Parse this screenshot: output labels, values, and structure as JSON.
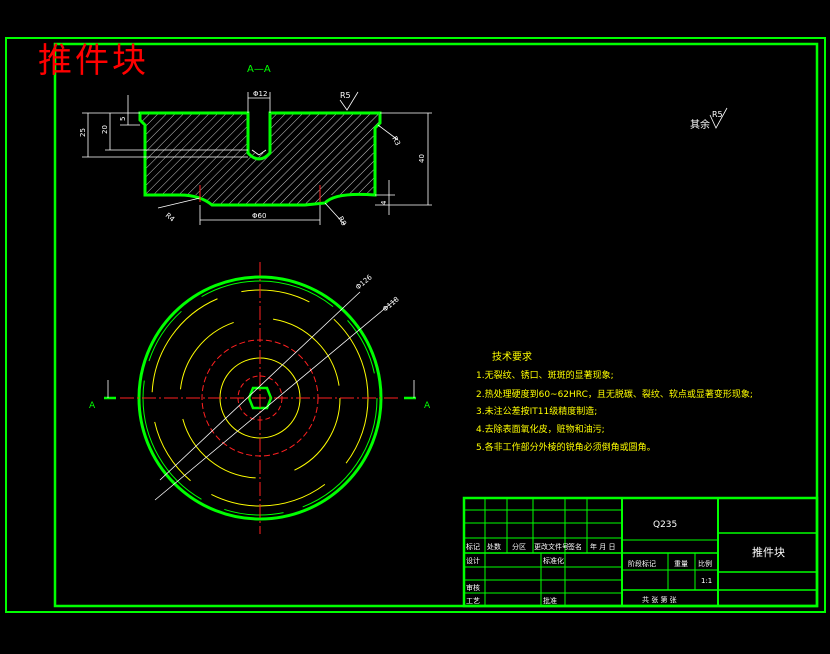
{
  "drawing": {
    "title": "推件块",
    "section_label": "A—A",
    "section_mark_left": "A",
    "section_mark_right": "A",
    "surface_finish_main": "R5",
    "surface_finish_rest_label": "其余",
    "surface_finish_rest": "R5"
  },
  "dimensions": {
    "top_hole": "Φ12",
    "height_25": "25",
    "height_20": "20",
    "depth_5": "5",
    "total_40": "40",
    "step_4": "4",
    "radius_r3": "R3",
    "radius_r4": "R4",
    "radius_r8": "R8",
    "bottom_dia": "Φ60",
    "dia_126": "Φ126",
    "dia_118": "Φ118"
  },
  "tech_requirements": {
    "heading": "技术要求",
    "items": [
      "1.无裂纹、锈口、斑斑的显著现象;",
      "2.热处理硬度到60~62HRC，且无脱碳、裂纹、软点或显著变形现象;",
      "3.未注公差按IT11级精度制造;",
      "4.去除表面氧化皮，赃物和油污;",
      "5.各非工作部分外棱的锐角必须倒角或圆角。"
    ]
  },
  "title_block": {
    "material": "Q235",
    "part_name": "推件块",
    "header_row": [
      "标记",
      "处数",
      "分区",
      "更改文件号",
      "签名",
      "年 月 日"
    ],
    "design_label": "设计",
    "standardize_label": "标准化",
    "review_label": "审核",
    "process_label": "工艺",
    "approve_label": "批准",
    "stage_label": "阶段标记",
    "weight_label": "重量",
    "scale_label": "比例",
    "scale_value": "1:1",
    "sheets_label": "共 张  第 张"
  }
}
